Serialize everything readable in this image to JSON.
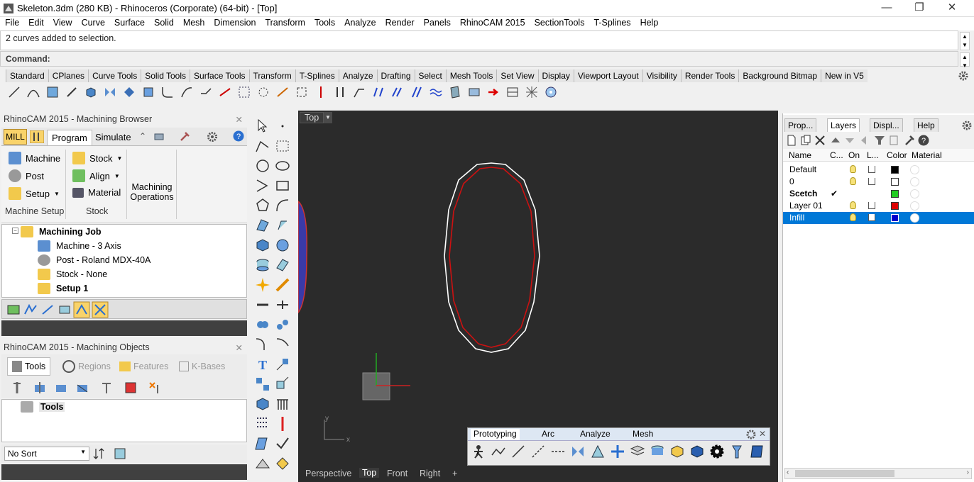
{
  "window": {
    "title": "Skeleton.3dm (280 KB) - Rhinoceros (Corporate) (64-bit) - [Top]",
    "min": "—",
    "max": "❐",
    "close": "✕"
  },
  "menu": [
    "File",
    "Edit",
    "View",
    "Curve",
    "Surface",
    "Solid",
    "Mesh",
    "Dimension",
    "Transform",
    "Tools",
    "Analyze",
    "Render",
    "Panels",
    "RhinoCAM 2015",
    "SectionTools",
    "T-Splines",
    "Help"
  ],
  "command": {
    "history": "2 curves added to selection.",
    "label": "Command:",
    "value": ""
  },
  "toolbar_tabs": [
    "Standard",
    "CPlanes",
    "Curve Tools",
    "Solid Tools",
    "Surface Tools",
    "Transform",
    "T-Splines",
    "Analyze",
    "Drafting",
    "Select",
    "Mesh Tools",
    "Set View",
    "Display",
    "Viewport Layout",
    "Visibility",
    "Render Tools",
    "Background Bitmap",
    "New in V5"
  ],
  "browser": {
    "title": "RhinoCAM 2015 - Machining Browser",
    "mill": "MILL",
    "tabs": [
      "Program",
      "Simulate"
    ],
    "buttons": {
      "machine": "Machine",
      "post": "Post",
      "setup": "Setup",
      "stock": "Stock",
      "align": "Align",
      "material": "Material",
      "machining_ops": "Machining Operations"
    },
    "groups": {
      "machine_setup": "Machine Setup",
      "stock": "Stock"
    },
    "tree": {
      "root": "Machining Job",
      "machine": "Machine - 3 Axis",
      "post": "Post - Roland MDX-40A",
      "stock": "Stock - None",
      "setup": "Setup 1"
    }
  },
  "objects": {
    "title": "RhinoCAM 2015 - Machining Objects",
    "tabs": [
      "Tools",
      "Regions",
      "Features",
      "K-Bases"
    ],
    "tree_root": "Tools",
    "sort": "No Sort"
  },
  "viewport": {
    "label": "Top",
    "axis_x": "x",
    "axis_y": "y",
    "tabs": [
      "Perspective",
      "Top",
      "Front",
      "Right"
    ],
    "add_tab": "+"
  },
  "floating_toolbar": {
    "tabs": [
      "Prototyping",
      "Arc",
      "Analyze",
      "Mesh"
    ]
  },
  "layers": {
    "tabs": [
      "Prop...",
      "Layers",
      "Displ...",
      "Help"
    ],
    "columns": [
      "Name",
      "C...",
      "On",
      "L...",
      "Color",
      "Material"
    ],
    "rows": [
      {
        "name": "Default",
        "color": "#000000",
        "current": false,
        "selected": false
      },
      {
        "name": "0",
        "color": "#ffffff",
        "current": false,
        "selected": false
      },
      {
        "name": "Scetch",
        "color": "#22cc22",
        "current": true,
        "selected": false
      },
      {
        "name": "Layer 01",
        "color": "#dd0000",
        "current": false,
        "selected": false
      },
      {
        "name": "Infill",
        "color": "#0000cc",
        "current": false,
        "selected": true
      }
    ],
    "current_mark": "✔"
  },
  "colors": {
    "accent_selected": "#0078d7",
    "curve_white": "#ffffff",
    "curve_red": "#cc1111",
    "viewport_bg": "#2b2b2b"
  }
}
